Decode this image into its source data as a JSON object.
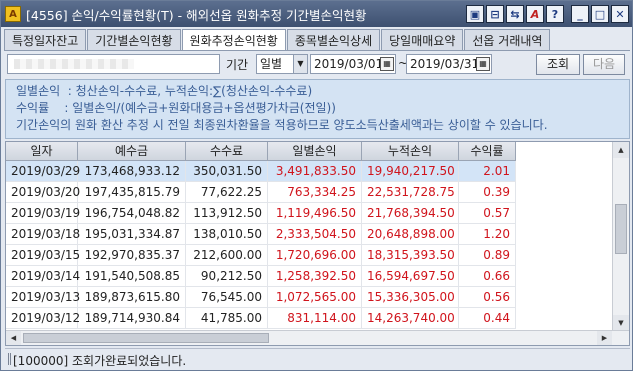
{
  "window": {
    "title": "[4556] 손익/수익률현황(T) - 해외선옵 원화추정 기간별손익현황",
    "app_icon_label": "A"
  },
  "title_buttons": [
    "▣",
    "⊟",
    "⇆",
    "A",
    "?",
    "_",
    "□",
    "✕"
  ],
  "tabs": [
    {
      "label": "특정일자잔고",
      "active": false
    },
    {
      "label": "기간별손익현황",
      "active": false
    },
    {
      "label": "원화추정손익현황",
      "active": true
    },
    {
      "label": "종목별손익상세",
      "active": false
    },
    {
      "label": "당일매매요약",
      "active": false
    },
    {
      "label": "선옵 거래내역",
      "active": false
    }
  ],
  "toolbar": {
    "period_label": "기간",
    "period_select": "일별",
    "date_from": "2019/03/01",
    "date_to": "2019/03/31",
    "tilde": "~",
    "query_button": "조회",
    "next_button": "다음"
  },
  "info": {
    "line1": "일별손익  : 청산손익-수수료, 누적손익:∑(청산손익-수수료)",
    "line2": "수익률    : 일별손익/(예수금+원화대용금+옵션평가차금(전일))",
    "line3": "기간손익의 원화 환산 추정 시 전일 최종원차환율을 적용하므로 양도소득산출세액과는 상이할 수 있습니다."
  },
  "grid": {
    "headers": [
      "일자",
      "예수금",
      "수수료",
      "일별손익",
      "누적손익",
      "수익률"
    ],
    "rows": [
      [
        "2019/03/29",
        "173,468,933.12",
        "350,031.50",
        "3,491,833.50",
        "19,940,217.50",
        "2.01"
      ],
      [
        "2019/03/20",
        "197,435,815.79",
        "77,622.25",
        "763,334.25",
        "22,531,728.75",
        "0.39"
      ],
      [
        "2019/03/19",
        "196,754,048.82",
        "113,912.50",
        "1,119,496.50",
        "21,768,394.50",
        "0.57"
      ],
      [
        "2019/03/18",
        "195,031,334.87",
        "138,010.50",
        "2,333,504.50",
        "20,648,898.00",
        "1.20"
      ],
      [
        "2019/03/15",
        "192,970,835.37",
        "212,600.00",
        "1,720,696.00",
        "18,315,393.50",
        "0.89"
      ],
      [
        "2019/03/14",
        "191,540,508.85",
        "90,212.50",
        "1,258,392.50",
        "16,594,697.50",
        "0.66"
      ],
      [
        "2019/03/13",
        "189,873,615.80",
        "76,545.00",
        "1,072,565.00",
        "15,336,305.00",
        "0.56"
      ],
      [
        "2019/03/12",
        "189,714,930.84",
        "41,785.00",
        "831,114.00",
        "14,263,740.00",
        "0.44"
      ]
    ],
    "selected_row": 0
  },
  "status": {
    "message": "[100000] 조회가완료되었습니다."
  },
  "colors": {
    "title_bar": "#4a5d7e",
    "info_text": "#3a5e96",
    "profit_red": "#d0141c",
    "selected_row": "#d3e4f7"
  }
}
